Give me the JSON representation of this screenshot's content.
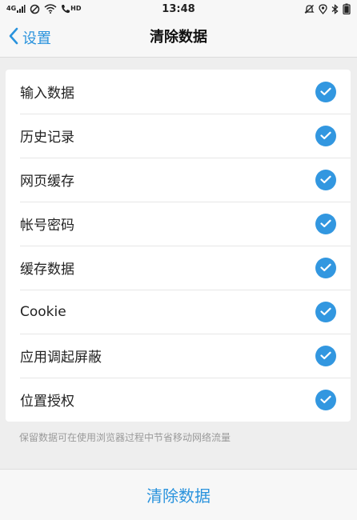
{
  "status_bar": {
    "time": "13:48",
    "network_label": "4G",
    "hd_label": "HD",
    "left_icons": [
      "signal-icon",
      "no-disturb-icon",
      "wifi-icon",
      "hd-call-icon"
    ],
    "right_icons": [
      "mute-bell-icon",
      "location-icon",
      "bluetooth-icon",
      "battery-icon"
    ]
  },
  "nav": {
    "back_label": "设置",
    "title": "清除数据"
  },
  "items": [
    {
      "label": "输入数据",
      "checked": true
    },
    {
      "label": "历史记录",
      "checked": true
    },
    {
      "label": "网页缓存",
      "checked": true
    },
    {
      "label": "帐号密码",
      "checked": true
    },
    {
      "label": "缓存数据",
      "checked": true
    },
    {
      "label": "Cookie",
      "checked": true
    },
    {
      "label": "应用调起屏蔽",
      "checked": true
    },
    {
      "label": "位置授权",
      "checked": true
    }
  ],
  "footnote": "保留数据可在使用浏览器过程中节省移动网络流量",
  "clear_button_label": "清除数据",
  "colors": {
    "accent": "#2a93dd",
    "check_fill": "#3297e0",
    "background": "#eeeeee"
  }
}
